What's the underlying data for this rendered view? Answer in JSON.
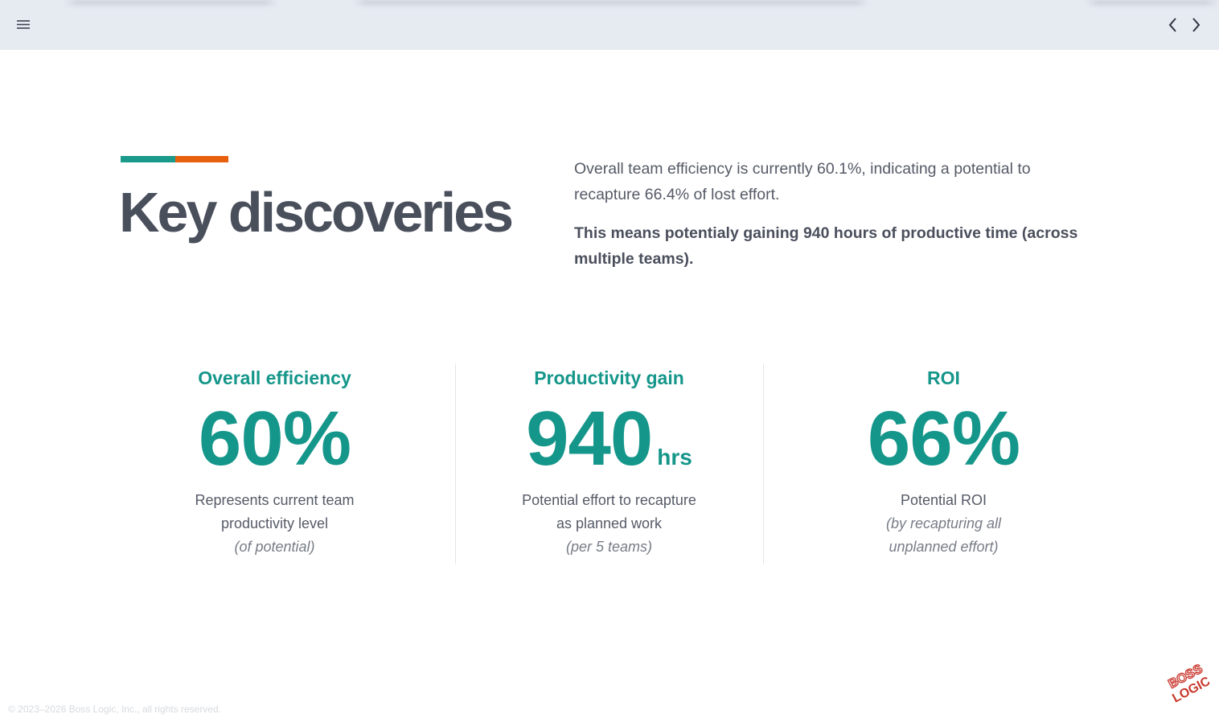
{
  "topbar": {
    "menu_icon": "hamburger-menu-icon",
    "prev_icon": "chevron-left-icon",
    "next_icon": "chevron-right-icon"
  },
  "colors": {
    "accent_teal": "#1a9a8a",
    "accent_orange": "#e8600e",
    "stat_teal": "#15968a",
    "heading": "#4a4f5c"
  },
  "header": {
    "title": "Key discoveries"
  },
  "intro": {
    "paragraph": "Overall team efficiency is currently 60.1%, indicating a potential to recapture 66.4% of lost effort.",
    "highlight": "This means potentialy gaining 940 hours of productive time (across multiple teams)."
  },
  "stats": [
    {
      "label": "Overall efficiency",
      "value": "60%",
      "unit": "",
      "description": "Represents current team productivity level",
      "note": "(of potential)"
    },
    {
      "label": "Productivity gain",
      "value": "940",
      "unit": "hrs",
      "description": "Potential effort to recapture as planned work",
      "note": "(per 5 teams)"
    },
    {
      "label": "ROI",
      "value": "66%",
      "unit": "",
      "description": "Potential ROI",
      "note": "(by recapturing all unplanned effort)"
    }
  ],
  "footer": {
    "copyright": "© 2023–2026 Boss Logic, Inc., all rights reserved."
  },
  "logo": {
    "line1": "BOSS",
    "line2": "LOGIC",
    "color": "#c8372d"
  }
}
